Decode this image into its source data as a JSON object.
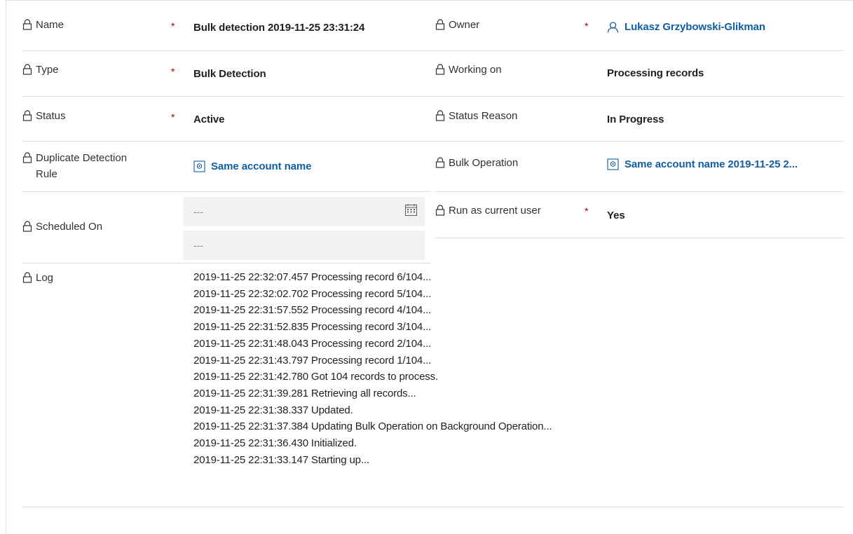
{
  "fields": {
    "name": {
      "label": "Name",
      "required": "*",
      "value": "Bulk detection 2019-11-25 23:31:24"
    },
    "owner": {
      "label": "Owner",
      "required": "*",
      "value": "Lukasz Grzybowski-Glikman",
      "icon": "person-icon"
    },
    "type": {
      "label": "Type",
      "required": "*",
      "value": "Bulk Detection"
    },
    "working_on": {
      "label": "Working on",
      "value": "Processing records"
    },
    "status": {
      "label": "Status",
      "required": "*",
      "value": "Active"
    },
    "status_reason": {
      "label": "Status Reason",
      "value": "In Progress"
    },
    "duplicate_rule": {
      "label_line1": "Duplicate Detection",
      "label_line2": "Rule",
      "value": "Same account name",
      "icon": "entity-record-icon"
    },
    "bulk_operation": {
      "label": "Bulk Operation",
      "value": "Same account name 2019-11-25 2...",
      "icon": "entity-record-icon"
    },
    "scheduled_on": {
      "label": "Scheduled On",
      "date_placeholder": "---",
      "time_placeholder": "---",
      "icon": "calendar-icon"
    },
    "run_as_current_user": {
      "label": "Run as current user",
      "required": "*",
      "value": "Yes"
    },
    "log": {
      "label": "Log",
      "lines": [
        "2019-11-25 22:32:07.457 Processing record 6/104...",
        "2019-11-25 22:32:02.702 Processing record 5/104...",
        "2019-11-25 22:31:57.552 Processing record 4/104...",
        "2019-11-25 22:31:52.835 Processing record 3/104...",
        "2019-11-25 22:31:48.043 Processing record 2/104...",
        "2019-11-25 22:31:43.797 Processing record 1/104...",
        "2019-11-25 22:31:42.780 Got 104 records to process.",
        "2019-11-25 22:31:39.281 Retrieving all records...",
        "2019-11-25 22:31:38.337 Updated.",
        "2019-11-25 22:31:37.384 Updating Bulk Operation on Background Operation...",
        "2019-11-25 22:31:36.430 Initialized.",
        "2019-11-25 22:31:33.147 Starting up..."
      ]
    }
  },
  "icons": {
    "lock": "lock-icon",
    "person": "person-icon",
    "entity": "entity-record-icon",
    "calendar": "calendar-icon"
  },
  "colors": {
    "required": "#a80000",
    "link": "#115ea3",
    "input_bg": "#f3f2f1",
    "separator": "#dcdcdc"
  }
}
